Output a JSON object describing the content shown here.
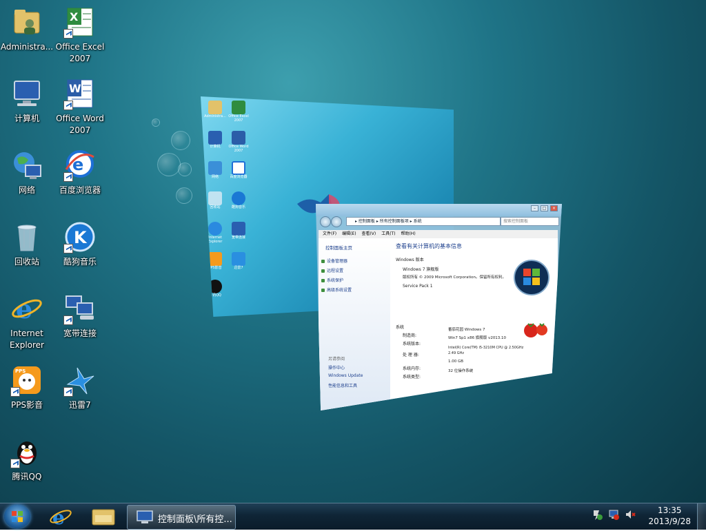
{
  "desktop_icons": [
    {
      "label": "Administra...",
      "icon": "user-folder-icon",
      "shortcut": false
    },
    {
      "label": "Office Excel\n2007",
      "icon": "excel-icon",
      "shortcut": true
    },
    {
      "label": "计算机",
      "icon": "computer-icon",
      "shortcut": false
    },
    {
      "label": "Office Word\n2007",
      "icon": "word-icon",
      "shortcut": true
    },
    {
      "label": "网络",
      "icon": "network-icon",
      "shortcut": false
    },
    {
      "label": "百度浏览器",
      "icon": "baidu-browser-icon",
      "shortcut": true
    },
    {
      "label": "回收站",
      "icon": "recycle-bin-icon",
      "shortcut": false
    },
    {
      "label": "酷狗音乐",
      "icon": "kugou-icon",
      "shortcut": true
    },
    {
      "label": "Internet\nExplorer",
      "icon": "ie-icon",
      "shortcut": false
    },
    {
      "label": "宽带连接",
      "icon": "broadband-icon",
      "shortcut": true
    },
    {
      "label": "PPS影音",
      "icon": "pps-icon",
      "shortcut": true
    },
    {
      "label": "迅雷7",
      "icon": "xunlei-icon",
      "shortcut": true
    },
    {
      "label": "腾讯QQ",
      "icon": "qq-icon",
      "shortcut": true
    }
  ],
  "window": {
    "address_path": "▸ 控制面板 ▸ 所有控制面板项 ▸ 系统",
    "search_placeholder": "搜索控制面板",
    "menu": [
      "文件(F)",
      "编辑(E)",
      "查看(V)",
      "工具(T)",
      "帮助(H)"
    ],
    "left_home": "控制面板主页",
    "left_links": [
      "设备管理器",
      "远程设置",
      "系统保护",
      "高级系统设置"
    ],
    "see_also_title": "另请参阅",
    "see_also": [
      "操作中心",
      "Windows Update",
      "性能信息和工具"
    ],
    "heading": "查看有关计算机的基本信息",
    "edition_section": "Windows 版本",
    "edition": "Windows 7 旗舰版",
    "copyright": "版权所有 © 2009 Microsoft Corporation。保留所有权利。",
    "service_pack": "Service Pack 1",
    "system_section": "系统",
    "manufacturer_label": "制造商:",
    "manufacturer_value": "番茄花园 Windows 7",
    "model_label": "系统版本:",
    "model_value": "Win7 Sp1 x86 旗舰版 v2013.10",
    "processor_label": "处 理 器:",
    "processor_value": "Intel(R) Core(TM) i5-3210M CPU @ 2.50GHz",
    "processor_value2": "2.49 GHz",
    "ram_label": "系统内存:",
    "ram_value": "1.00 GB",
    "type_label": "系统类型:",
    "type_value": "32 位操作系统"
  },
  "taskbar": {
    "task_label": "控制面板\\所有控...",
    "time": "13:35",
    "date": "2013/9/28"
  }
}
